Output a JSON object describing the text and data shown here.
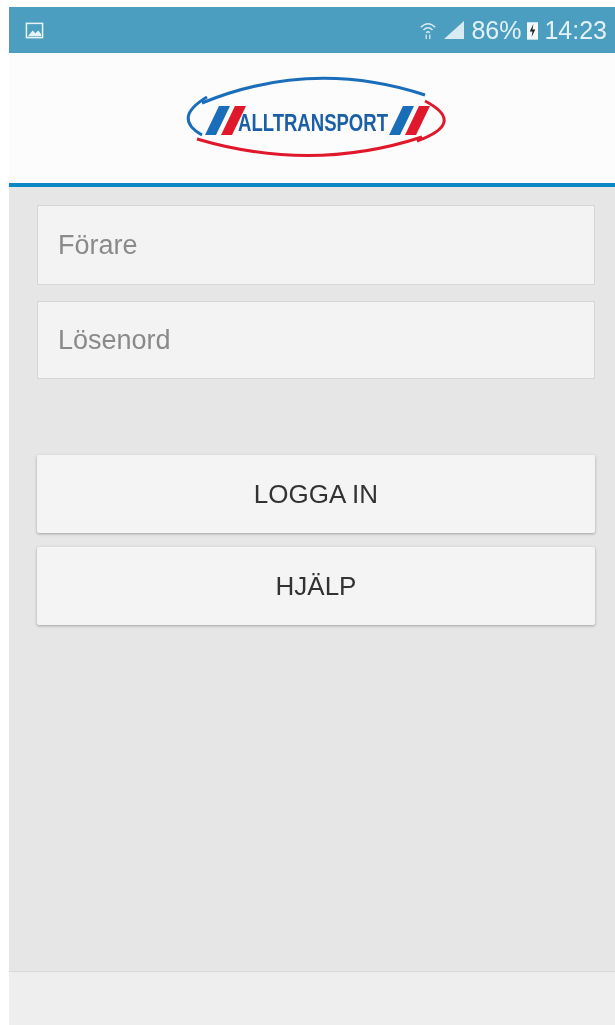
{
  "status_bar": {
    "battery": "86%",
    "time": "14:23"
  },
  "header": {
    "logo_text": "ALLTRANSPORT"
  },
  "fields": [
    {
      "placeholder": "Förare"
    },
    {
      "placeholder": "Lösenord"
    }
  ],
  "buttons": [
    "LOGGA IN",
    "HJÄLP"
  ]
}
